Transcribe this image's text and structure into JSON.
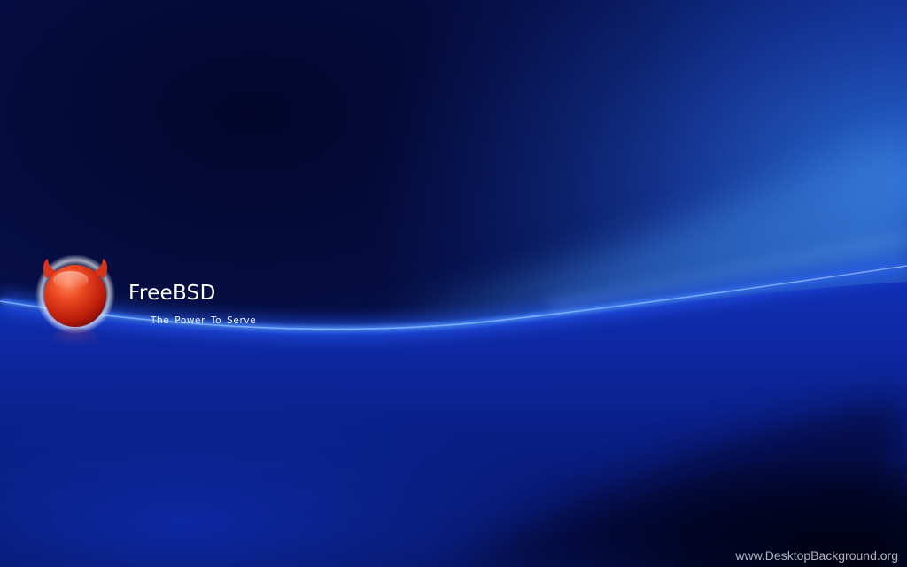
{
  "wallpaper": {
    "brand": {
      "name": "FreeBSD",
      "tagline": "The  Power To Serve",
      "logo_icon": "freebsd-daemon-icon"
    },
    "watermark": "www.DesktopBackground.org",
    "colors": {
      "background_dark": "#040828",
      "background_blue": "#0a2a9a",
      "wave_glow": "#2f6dff",
      "wave_light": "#4a8ae0",
      "logo_red": "#e23a1a"
    }
  }
}
